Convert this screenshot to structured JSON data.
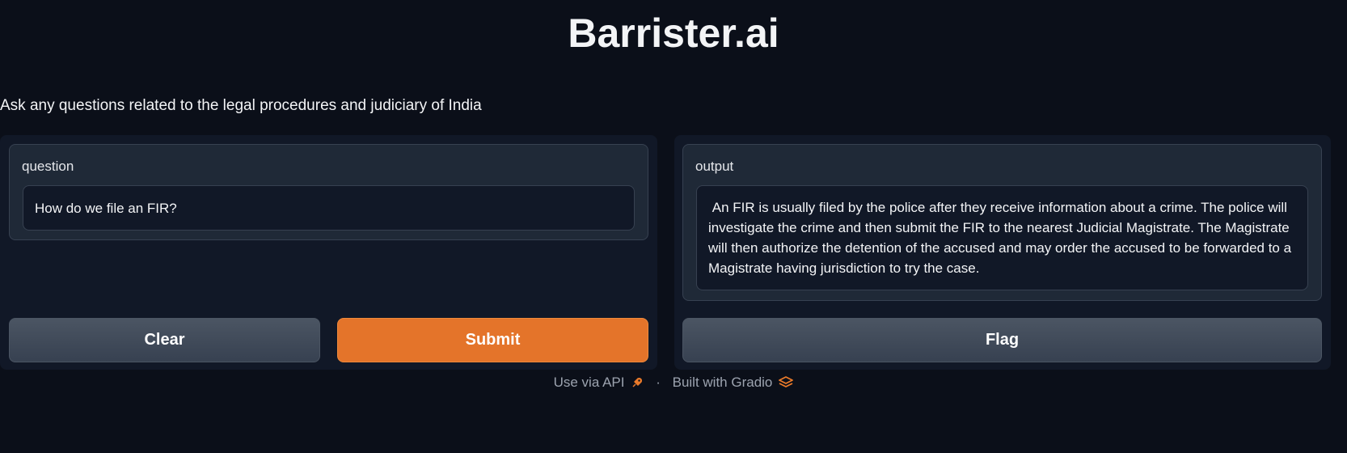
{
  "app": {
    "title": "Barrister.ai",
    "description": "Ask any questions related to the legal procedures and judiciary of India"
  },
  "input": {
    "label": "question",
    "value": "How do we file an FIR?"
  },
  "output": {
    "label": "output",
    "value": " An FIR is usually filed by the police after they receive information about a crime. The police will investigate the crime and then submit the FIR to the nearest Judicial Magistrate. The Magistrate will then authorize the detention of the accused and may order the accused to be forwarded to a Magistrate having jurisdiction to try the case."
  },
  "buttons": {
    "clear": "Clear",
    "submit": "Submit",
    "flag": "Flag"
  },
  "footer": {
    "api_link": "Use via API",
    "separator": "·",
    "built_with": "Built with Gradio",
    "api_icon": "rocket-icon",
    "gradio_icon": "gradio-logo-icon"
  },
  "colors": {
    "background": "#0b0f19",
    "panel": "#111827",
    "block": "#1f2937",
    "accent": "#e4742a"
  }
}
